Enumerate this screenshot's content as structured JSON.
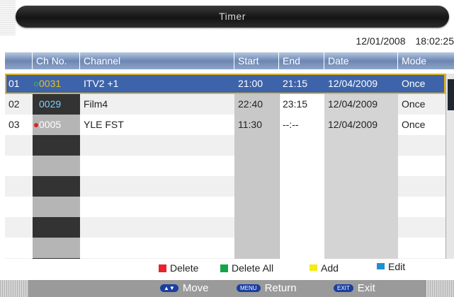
{
  "title": "Timer",
  "date": "12/01/2008",
  "time": "18:02:25",
  "headers": {
    "blank": "",
    "ch_no": "Ch No.",
    "channel": "Channel",
    "start": "Start",
    "end": "End",
    "date": "Date",
    "mode": "Mode"
  },
  "rows": [
    {
      "idx": "01",
      "ch": "0031",
      "name": "ITV2 +1",
      "start": "21:00",
      "end": "21:15",
      "date": "12/04/2009",
      "mode": "Once",
      "dot": "#3ec04a",
      "ch_color": "#e3c020"
    },
    {
      "idx": "02",
      "ch": "0029",
      "name": "Film4",
      "start": "22:40",
      "end": "23:15",
      "date": "12/04/2009",
      "mode": "Once",
      "dot": "",
      "ch_color": "#7fd0f5"
    },
    {
      "idx": "03",
      "ch": "0005",
      "name": "YLE FST",
      "start": "11:30",
      "end": "--:--",
      "date": "12/04/2009",
      "mode": "Once",
      "dot": "#e02020",
      "ch_color": "#ffffff"
    }
  ],
  "legend": {
    "delete": "Delete",
    "delete_all": "Delete All",
    "add": "Add",
    "edit": "Edit"
  },
  "colors": {
    "delete": "#e8222e",
    "delete_all": "#13a54a",
    "add": "#f5ec14",
    "edit": "#1e90d0",
    "header_bg": "#6c86b2",
    "selection": "#3d63aa"
  },
  "nav": {
    "move_key": "▲▼",
    "move": "Move",
    "return_key": "MENU",
    "return": "Return",
    "exit_key": "EXIT",
    "exit": "Exit"
  }
}
